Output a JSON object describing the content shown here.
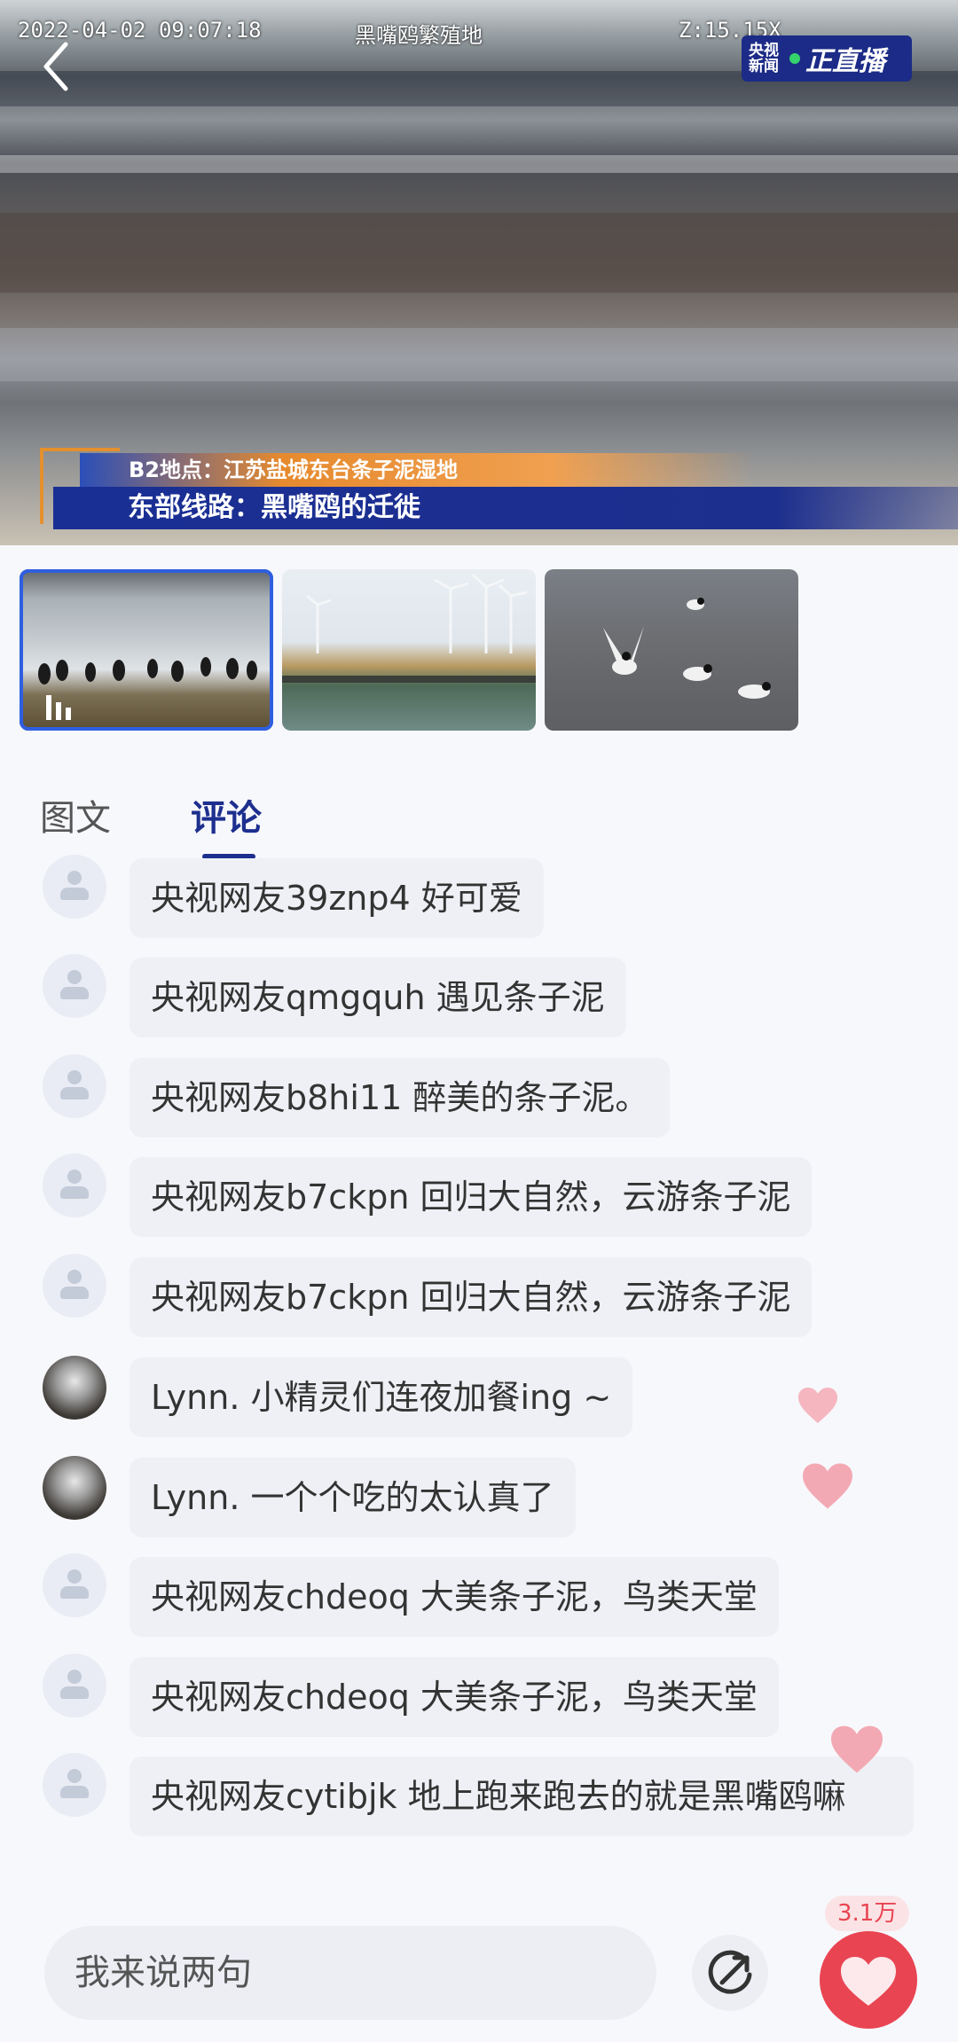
{
  "video": {
    "timestamp": "2022-04-02 09:07:18",
    "location_caption": "黑嘴鸥繁殖地",
    "right_counter": "Z:15.15X",
    "badge_logo": "央视新闻",
    "badge_text": "正直播",
    "lower_third_top": "B2地点：江苏盐城东台条子泥湿地",
    "lower_third_bottom": "东部线路：黑嘴鸥的迁徙"
  },
  "thumbnails": [
    {
      "label": "view-1",
      "active": true
    },
    {
      "label": "view-2",
      "active": false
    },
    {
      "label": "view-3",
      "active": false
    }
  ],
  "tabs": {
    "graphic": "图文",
    "comments": "评论"
  },
  "comments": [
    {
      "text": "央视网友39znp4 好可爱"
    },
    {
      "text": "央视网友qmgquh 遇见条子泥"
    },
    {
      "text": "央视网友b8hi11 醉美的条子泥。"
    },
    {
      "text": "央视网友b7ckpn 回归大自然，云游条子泥"
    },
    {
      "text": "央视网友b7ckpn 回归大自然，云游条子泥"
    },
    {
      "text": "Lynn. 小精灵们连夜加餐ing ~"
    },
    {
      "text": "Lynn. 一个个吃的太认真了"
    },
    {
      "text": "央视网友chdeoq 大美条子泥，鸟类天堂"
    },
    {
      "text": "央视网友chdeoq 大美条子泥，鸟类天堂"
    },
    {
      "text": "央视网友cytibjk 地上跑来跑去的就是黑嘴鸥嘛"
    }
  ],
  "bottom": {
    "input_placeholder": "我来说两句",
    "like_count": "3.1万"
  },
  "colors": {
    "accent": "#1d2f8e",
    "like": "#e94452"
  }
}
